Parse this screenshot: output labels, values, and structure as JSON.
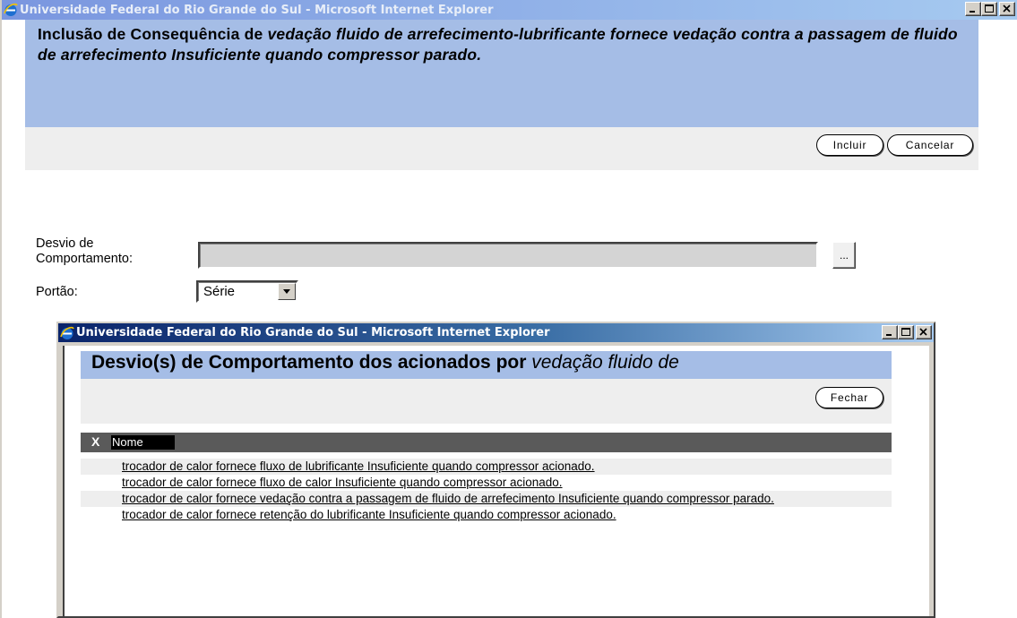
{
  "outer_window": {
    "title": "Universidade Federal do Rio Grande do Sul - Microsoft Internet Explorer",
    "header_prefix": "Inclusão de Consequência de ",
    "header_italic": "vedação fluido de arrefecimento-lubrificante fornece vedação contra a passagem de fluido de arrefecimento Insuficiente quando compressor parado.",
    "include_label": "Incluir",
    "cancel_label": "Cancelar",
    "desvio_label": "Desvio de Comportamento:",
    "desvio_value": "",
    "browse_label": "...",
    "portao_label": "Portão:",
    "portao_selected": "Série"
  },
  "popup_window": {
    "title": "Universidade Federal do Rio Grande do Sul - Microsoft Internet Explorer",
    "header_prefix": "Desvio(s) de Comportamento dos acionados por ",
    "header_italic": "vedação fluido de",
    "close_label": "Fechar",
    "table": {
      "col_x": "X",
      "col_name": "Nome",
      "rows": [
        "trocador de calor fornece fluxo de lubrificante Insuficiente quando compressor acionado.",
        "trocador de calor fornece fluxo de calor Insuficiente quando compressor acionado.",
        "trocador de calor fornece vedação contra a passagem de fluido de arrefecimento Insuficiente quando compressor parado.",
        "trocador de calor fornece retenção do lubrificante Insuficiente quando compressor acionado."
      ]
    }
  },
  "colors": {
    "header_band": "#a5bde6",
    "action_band": "#eeeeee",
    "grid_header": "#5a5a5a"
  },
  "icons": [
    "ie-icon",
    "minimize-icon",
    "maximize-icon",
    "close-icon",
    "dropdown-arrow-icon"
  ]
}
